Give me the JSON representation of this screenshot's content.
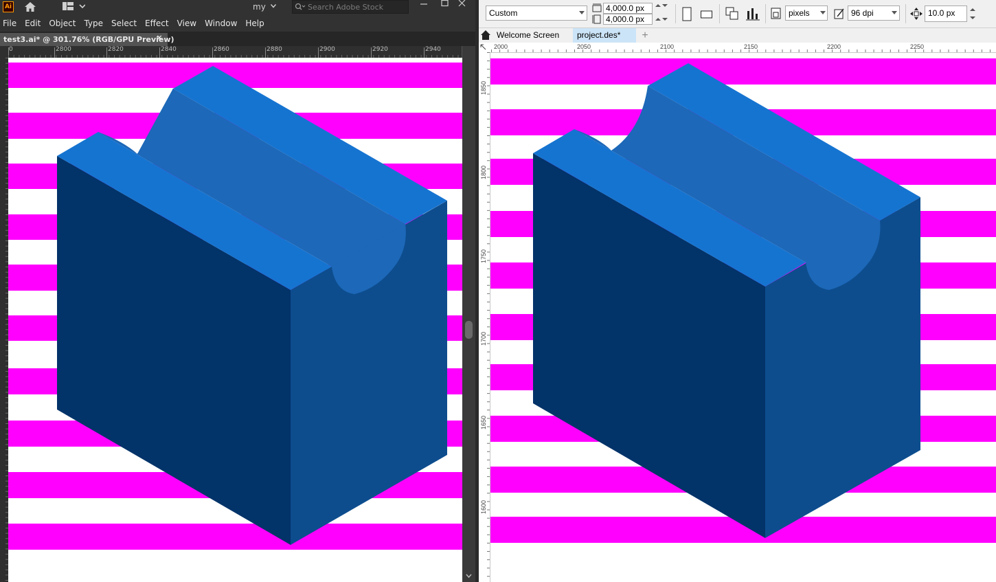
{
  "colors": {
    "stripe_magenta": "#ff00ff",
    "block_top": "#1674d1",
    "block_groove": "#1d68b8",
    "block_front": "#023369",
    "block_right": "#0d4d8e",
    "ai_chrome": "#323232",
    "designer_chrome": "#f0f0f0"
  },
  "left_app": {
    "logo_text": "Ai",
    "workspace_label": "my",
    "search_placeholder": "Search Adobe Stock",
    "menu": [
      "File",
      "Edit",
      "Object",
      "Type",
      "Select",
      "Effect",
      "View",
      "Window",
      "Help"
    ],
    "doc_tab_title": "test3.ai* @ 301.76% (RGB/GPU Preview)",
    "doc_tab_close": "×",
    "ruler_h_start": "0",
    "ruler_h": [
      "2800",
      "2820",
      "2840",
      "2860",
      "2880",
      "2900",
      "2920",
      "2940"
    ]
  },
  "right_app": {
    "preset": "Custom",
    "width_value": "4,000.0 px",
    "height_value": "4,000.0 px",
    "units": "pixels",
    "dpi": "96 dpi",
    "nudge": "10.0 px",
    "tabs": [
      "Welcome Screen",
      "project.des*"
    ],
    "add_tab": "+",
    "ruler_h": [
      "2000",
      "2050",
      "2100",
      "2150",
      "2200",
      "2250"
    ],
    "ruler_v": [
      "1850",
      "1800",
      "1750",
      "1700",
      "1650",
      "1600"
    ]
  }
}
